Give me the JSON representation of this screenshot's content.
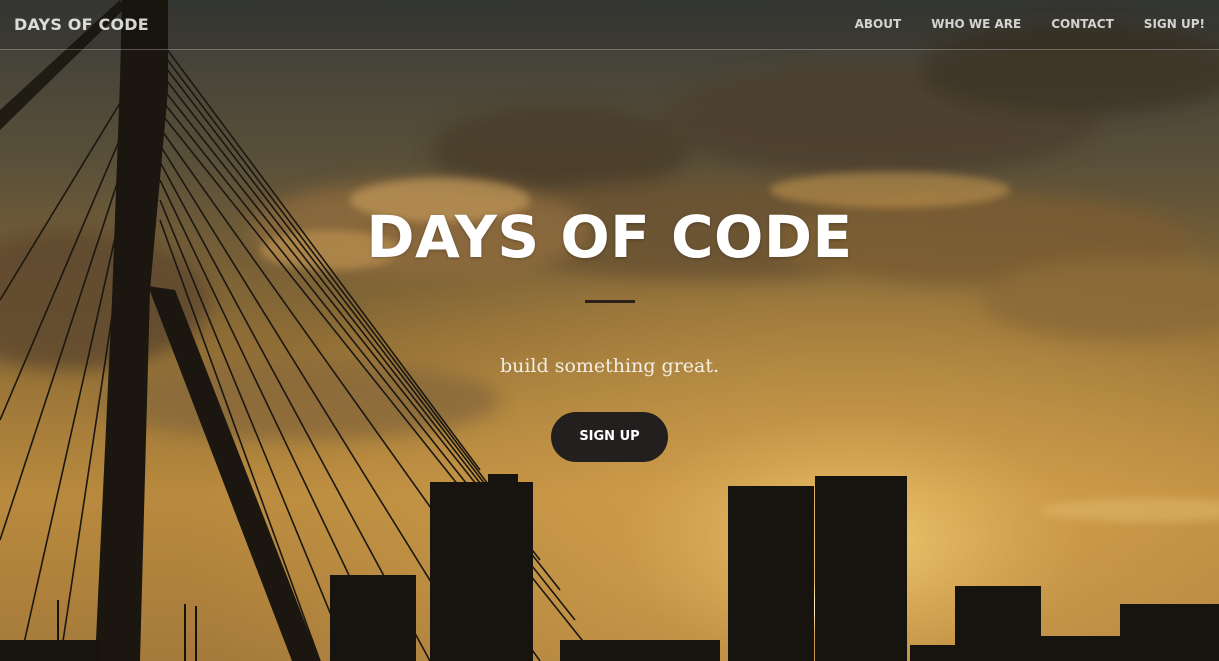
{
  "navbar": {
    "brand": "DAYS OF CODE",
    "links": [
      {
        "label": "ABOUT"
      },
      {
        "label": "WHO WE ARE"
      },
      {
        "label": "CONTACT"
      },
      {
        "label": "SIGN UP!"
      }
    ]
  },
  "hero": {
    "title": "DAYS OF CODE",
    "subtitle": "build something great.",
    "cta_label": "SIGN UP"
  },
  "colors": {
    "sky_top": "#3a3d38",
    "sky_mid": "#8a6a35",
    "sky_glow": "#d8a64a",
    "silhouette": "#1b1710",
    "button_bg": "#231f1e",
    "divider": "#2a2119"
  }
}
